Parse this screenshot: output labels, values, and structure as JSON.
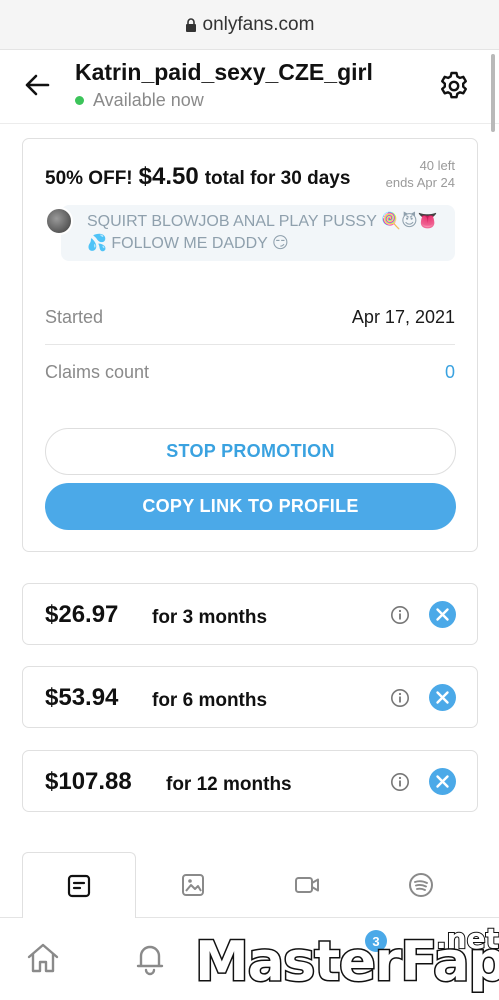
{
  "browser": {
    "url": "onlyfans.com"
  },
  "header": {
    "title": "Katrin_paid_sexy_CZE_girl",
    "status": "Available now"
  },
  "promotion": {
    "discount": "50% OFF!",
    "price": "$4.50",
    "period": "total for 30 days",
    "left": "40 left",
    "ends": "ends Apr 24",
    "message_line1": "SQUIRT BLOWJOB ANAL PLAY PUSSY 🍭😈👅",
    "message_line2": "💦 FOLLOW ME DADDY 😏",
    "started_label": "Started",
    "started_value": "Apr 17, 2021",
    "claims_label": "Claims count",
    "claims_value": "0",
    "stop_label": "STOP PROMOTION",
    "copy_label": "COPY LINK TO PROFILE"
  },
  "plans": [
    {
      "price": "$26.97",
      "duration": "for 3 months"
    },
    {
      "price": "$53.94",
      "duration": "for 6 months"
    },
    {
      "price": "$107.88",
      "duration": "for 12 months"
    }
  ],
  "tabs": [
    "posts-icon",
    "photos-icon",
    "videos-icon",
    "spotify-icon"
  ],
  "bottom_nav": {
    "notifications_badge": "3"
  },
  "watermark": {
    "text": "MasterFap",
    "suffix": ".net"
  },
  "colors": {
    "accent": "#4ba9e8",
    "online": "#3cc45a"
  }
}
